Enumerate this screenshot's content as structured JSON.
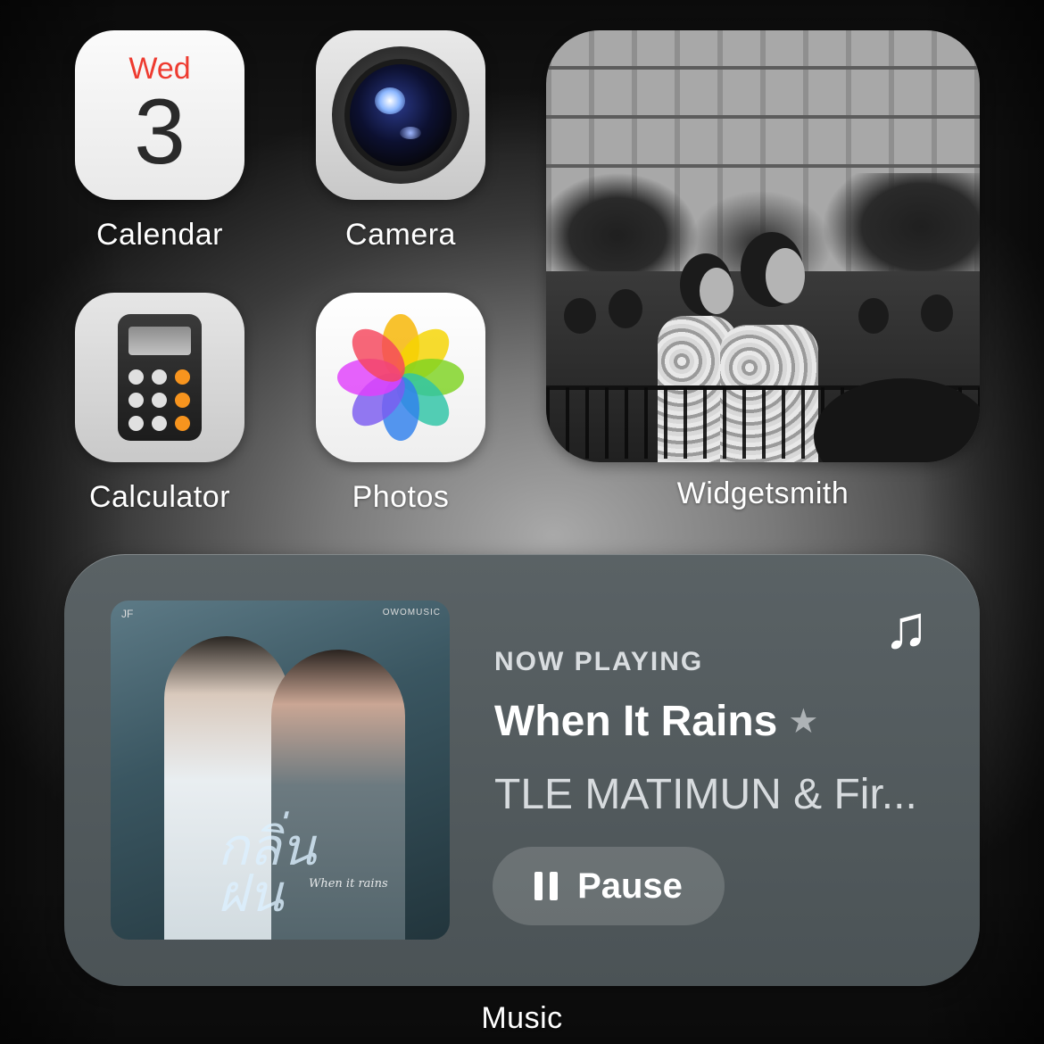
{
  "apps": [
    {
      "label": "Calendar",
      "icon": "calendar-icon",
      "day": "Wed",
      "date": "3",
      "accent": "#ee3b30"
    },
    {
      "label": "Camera",
      "icon": "camera-icon"
    },
    {
      "label": "Calculator",
      "icon": "calculator-icon",
      "accent": "#f7941e"
    },
    {
      "label": "Photos",
      "icon": "photos-icon"
    }
  ],
  "widgetsmith": {
    "label": "Widgetsmith"
  },
  "music": {
    "label": "Music",
    "status": "NOW PLAYING",
    "title": "When It Rains",
    "artist": "TLE MATIMUN & Fir...",
    "pause_label": "Pause",
    "album": {
      "script": "กลิ่น\nฝน",
      "subtitle": "When it rains",
      "corner_left": "JF",
      "corner_right": "OWOMUSIC"
    }
  }
}
